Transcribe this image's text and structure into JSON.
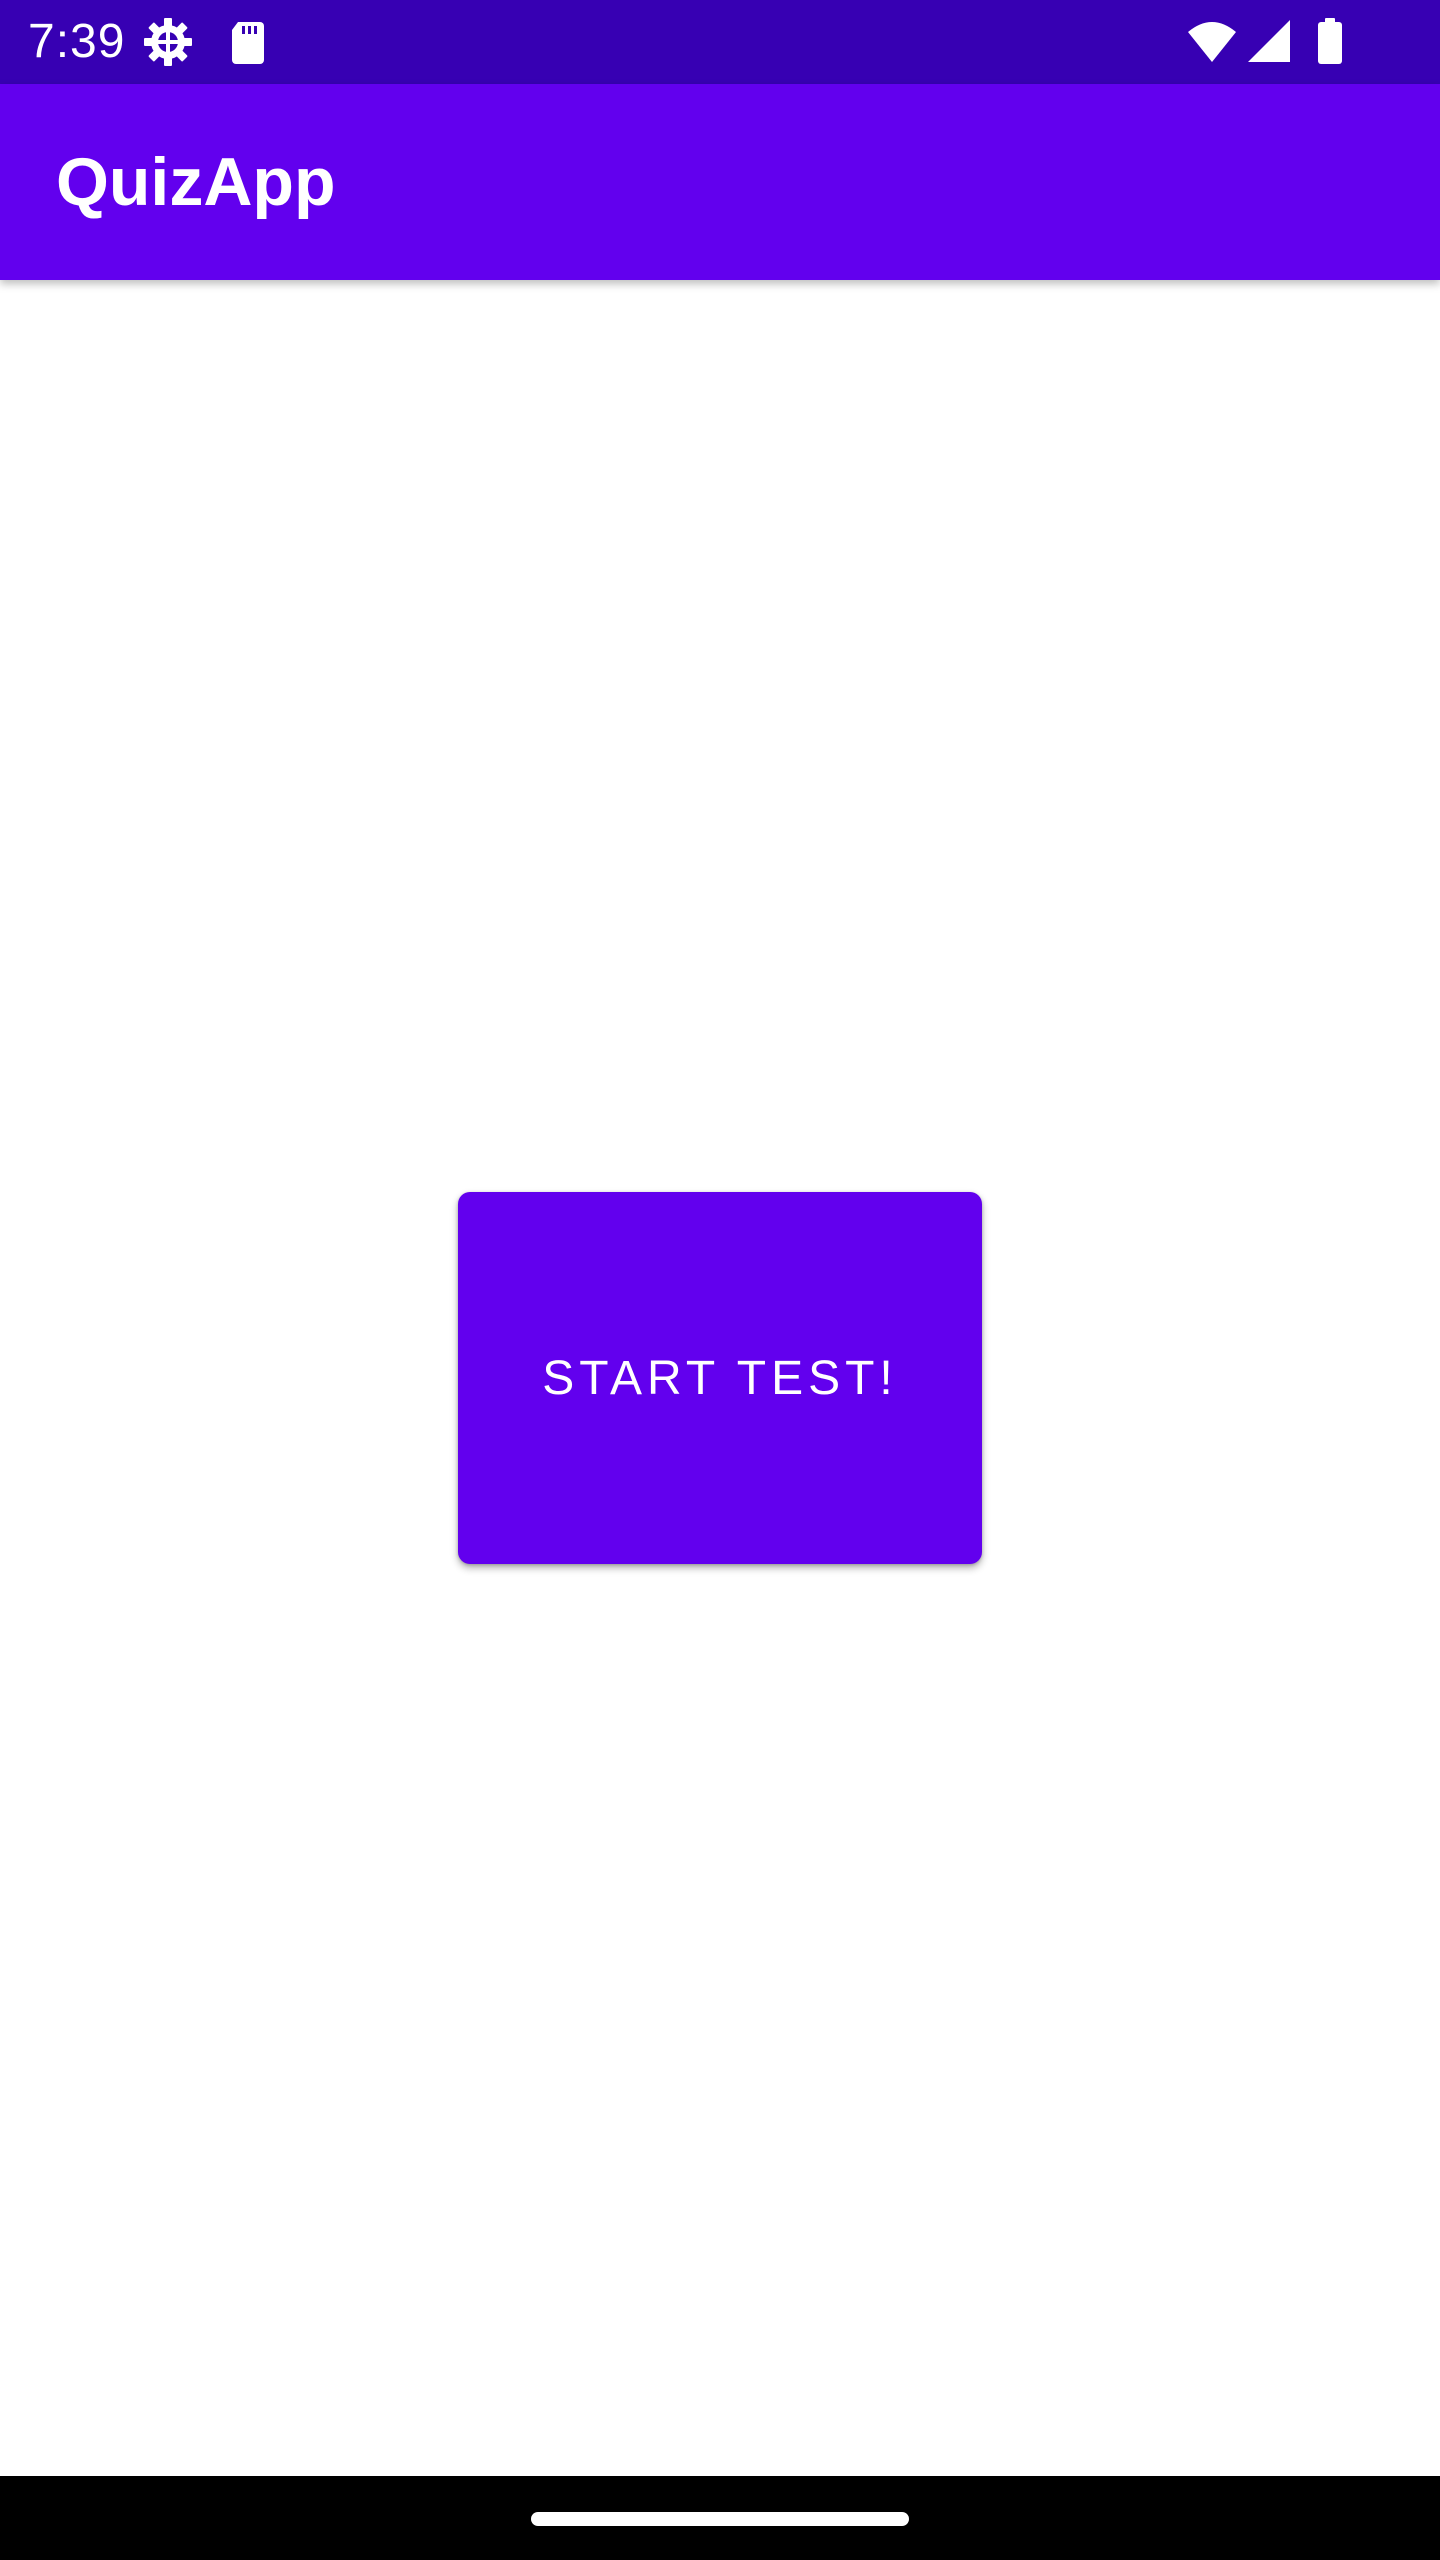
{
  "status_bar": {
    "time": "7:39",
    "background_color": "#3700b3",
    "icons_left": [
      "settings-gear-icon",
      "sd-card-icon"
    ],
    "icons_right": [
      "wifi-icon",
      "cellular-signal-icon",
      "battery-icon"
    ]
  },
  "app_bar": {
    "title": "QuizApp",
    "background_color": "#6200ee"
  },
  "main": {
    "start_button_label": "START TEST!",
    "button_color": "#6200ee"
  },
  "nav_bar": {
    "home_handle": "home-gesture-handle"
  }
}
